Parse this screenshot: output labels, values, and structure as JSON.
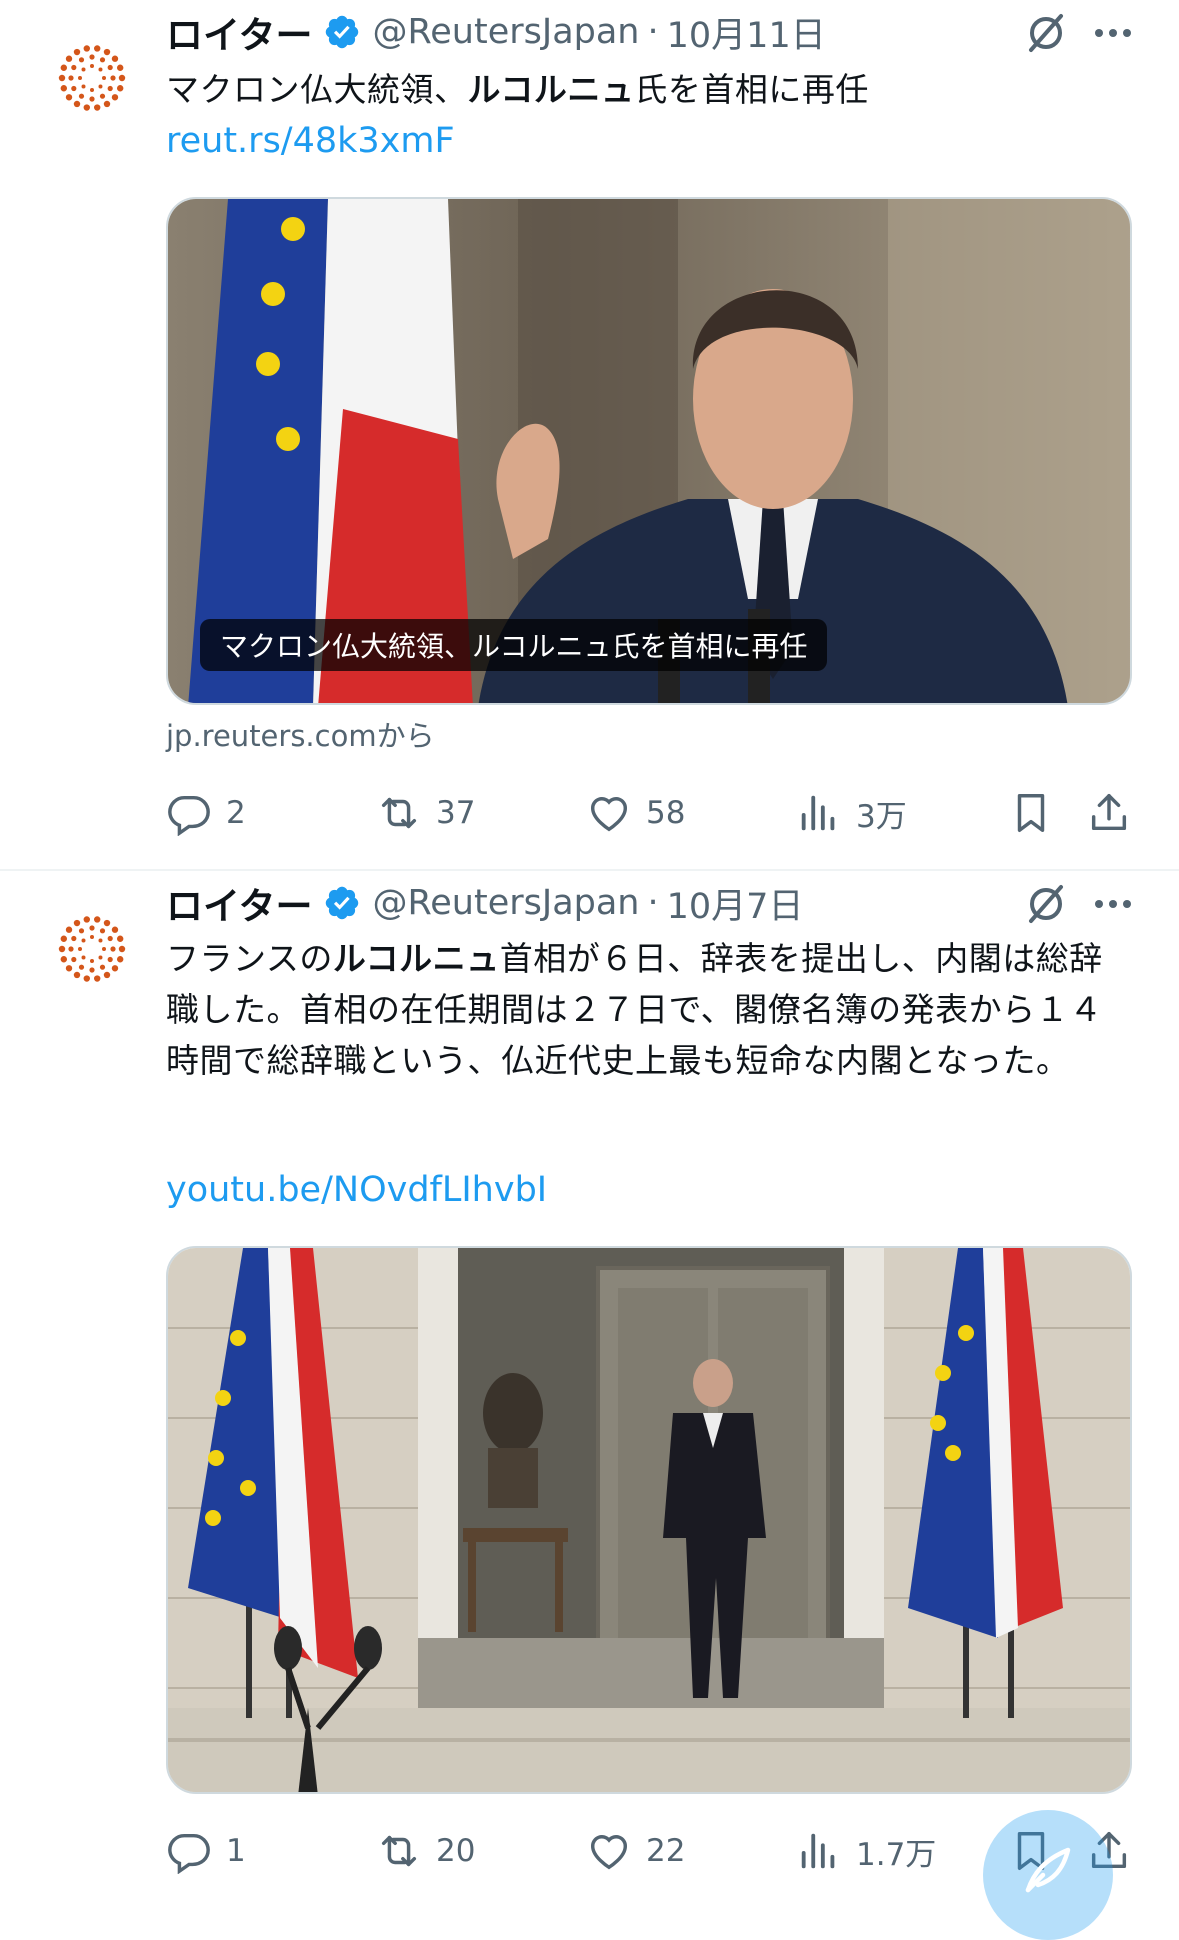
{
  "tweets": [
    {
      "author_name": "ロイター",
      "handle": "@ReutersJapan",
      "date": "10月11日",
      "text_parts": [
        "マクロン仏大統領、",
        "ルコルニュ",
        "氏を首相に再任"
      ],
      "link": "reut.rs/48k3xmF",
      "card_caption": "マクロン仏大統領、ルコルニュ氏を首相に再任",
      "card_source": "jp.reuters.comから",
      "replies": "2",
      "reposts": "37",
      "likes": "58",
      "views": "3万"
    },
    {
      "author_name": "ロイター",
      "handle": "@ReutersJapan",
      "date": "10月7日",
      "text_parts": [
        "フランスの",
        "ルコルニュ",
        "首相が６日、辞表を提出し、内閣は総辞職した。首相の在任期間は２７日で、閣僚名簿の発表から１４時間で総辞職という、仏近代史上最も短命な内閣となった。"
      ],
      "link": "youtu.be/NOvdfLIhvbI",
      "replies": "1",
      "reposts": "20",
      "likes": "22",
      "views": "1.7万"
    }
  ],
  "separator": "·",
  "icons": {
    "avatar": "reuters-logo",
    "verified": "verified-badge-icon",
    "grok": "grok-icon",
    "more": "more-icon",
    "reply": "reply-icon",
    "repost": "repost-icon",
    "like": "heart-icon",
    "views": "views-icon",
    "bookmark": "bookmark-icon",
    "share": "share-icon",
    "compose": "compose-icon"
  },
  "colors": {
    "link": "#1d9bf0",
    "secondary_text": "#536471",
    "verified": "#1d9bf0",
    "reuters_orange": "#d4561a"
  }
}
